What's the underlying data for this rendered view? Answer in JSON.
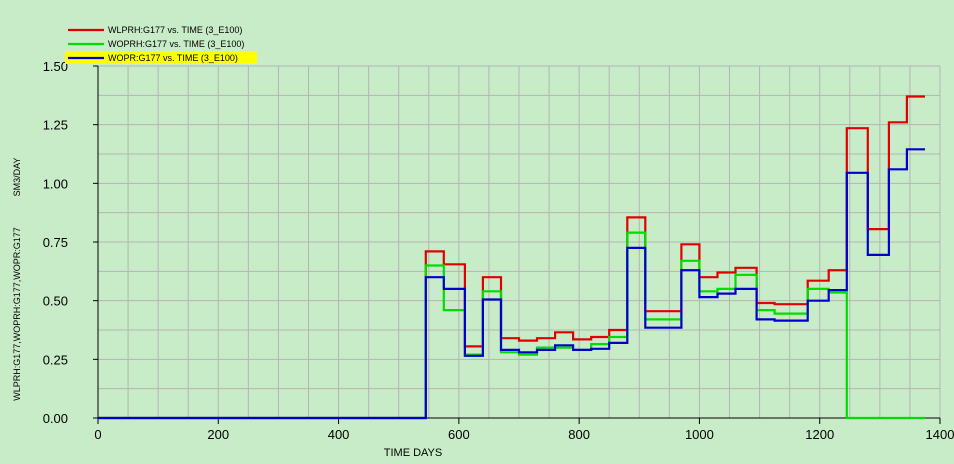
{
  "chart_data": {
    "type": "line",
    "step": true,
    "xlabel": "TIME   DAYS",
    "ylabel": "WLPRH:G177,WOPRH:G177,WOPR:G177",
    "yunit": "SM3/DAY",
    "xlim": [
      0,
      1400
    ],
    "ylim": [
      0,
      1.5
    ],
    "xticks": [
      0,
      200,
      400,
      600,
      800,
      1000,
      1200,
      1400
    ],
    "xtick_labels": [
      "0",
      "200",
      "400",
      "600",
      "800",
      "1000",
      "1200",
      "1400"
    ],
    "yticks": [
      0,
      0.25,
      0.5,
      0.75,
      1.0,
      1.25,
      1.5
    ],
    "ytick_labels": [
      "0.00",
      "0.25",
      "0.50",
      "0.75",
      "1.00",
      "1.25",
      "1.50"
    ],
    "grid": true,
    "legend_position": "top-left",
    "background_color": "#c8ecc8",
    "grid_color": "#b4b4b4",
    "series": [
      {
        "name": "WLPRH:G177  vs.  TIME (3_E100)",
        "color": "#e00000",
        "highlighted": false,
        "x": [
          0,
          545,
          575,
          610,
          640,
          670,
          700,
          730,
          760,
          790,
          820,
          850,
          880,
          910,
          970,
          1000,
          1030,
          1060,
          1095,
          1125,
          1180,
          1215,
          1245,
          1280,
          1315,
          1345
        ],
        "y": [
          0,
          0.71,
          0.655,
          0.305,
          0.6,
          0.34,
          0.33,
          0.34,
          0.365,
          0.335,
          0.345,
          0.375,
          0.855,
          0.455,
          0.74,
          0.6,
          0.62,
          0.64,
          0.49,
          0.485,
          0.585,
          0.63,
          1.235,
          0.805,
          1.26,
          1.37
        ]
      },
      {
        "name": "WOPRH:G177  vs.  TIME (3_E100)",
        "color": "#00dd00",
        "highlighted": false,
        "x": [
          0,
          545,
          575,
          610,
          640,
          670,
          700,
          730,
          760,
          790,
          820,
          850,
          880,
          910,
          970,
          1000,
          1030,
          1060,
          1095,
          1125,
          1180,
          1215,
          1245,
          1280,
          1315,
          1345
        ],
        "y": [
          0,
          0.65,
          0.46,
          0.27,
          0.54,
          0.28,
          0.27,
          0.3,
          0.3,
          0.29,
          0.315,
          0.345,
          0.79,
          0.42,
          0.67,
          0.54,
          0.55,
          0.61,
          0.46,
          0.445,
          0.55,
          0.535,
          0,
          0,
          0,
          0
        ]
      },
      {
        "name": "WOPR:G177  vs.  TIME (3_E100)",
        "color": "#0000cc",
        "highlighted": true,
        "x": [
          0,
          545,
          575,
          610,
          640,
          670,
          700,
          730,
          760,
          790,
          820,
          850,
          880,
          910,
          970,
          1000,
          1030,
          1060,
          1095,
          1125,
          1180,
          1215,
          1245,
          1280,
          1315,
          1345
        ],
        "y": [
          0,
          0.6,
          0.55,
          0.265,
          0.505,
          0.29,
          0.28,
          0.29,
          0.31,
          0.29,
          0.295,
          0.32,
          0.725,
          0.385,
          0.63,
          0.515,
          0.53,
          0.55,
          0.42,
          0.415,
          0.5,
          0.545,
          1.045,
          0.695,
          1.06,
          1.145
        ]
      }
    ]
  }
}
